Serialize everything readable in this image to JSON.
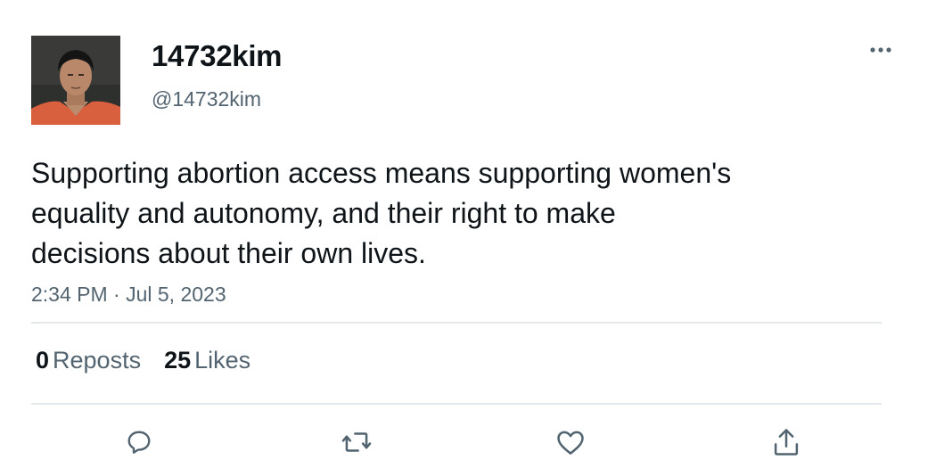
{
  "author": {
    "display_name": "14732kim",
    "handle": "@14732kim",
    "avatar_icon": "profile-photo"
  },
  "tweet": {
    "text_lines": [
      "Supporting abortion access means supporting women's",
      "equality and autonomy, and their right to make",
      "decisions about their own lives."
    ],
    "timestamp": "2:34 PM · Jul 5, 2023"
  },
  "stats": {
    "reposts_count": "0",
    "reposts_label": "Reposts",
    "likes_count": "25",
    "likes_label": "Likes"
  },
  "actions": {
    "icons": [
      "reply-icon",
      "repost-icon",
      "like-icon",
      "share-icon"
    ]
  },
  "colors": {
    "text_primary": "#0f1419",
    "text_secondary": "#536471",
    "divider": "#e5e8ea",
    "icon": "#536471"
  }
}
